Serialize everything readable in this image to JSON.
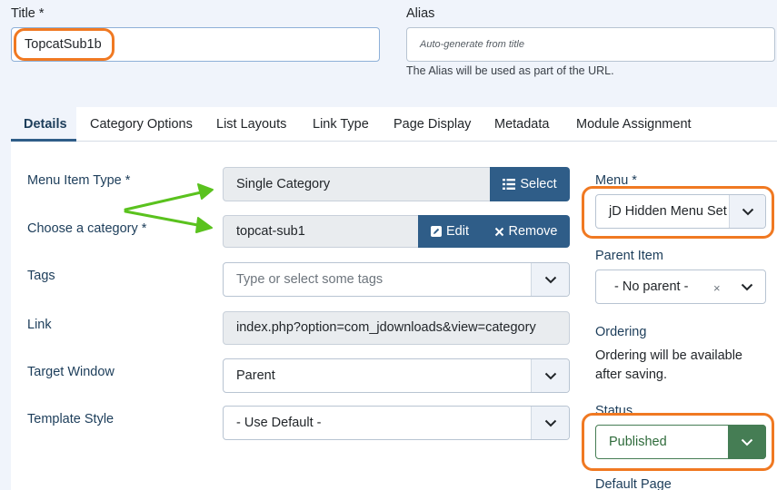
{
  "title_field": {
    "label": "Title *",
    "value": "TopcatSub1b"
  },
  "alias_field": {
    "label": "Alias",
    "placeholder": "Auto-generate from title",
    "hint": "The Alias will be used as part of the URL."
  },
  "tabs": [
    "Details",
    "Category Options",
    "List Layouts",
    "Link Type",
    "Page Display",
    "Metadata",
    "Module Assignment"
  ],
  "details": {
    "menu_item_type": {
      "label": "Menu Item Type *",
      "value": "Single Category",
      "select_label": "Select"
    },
    "category": {
      "label": "Choose a category *",
      "value": "topcat-sub1",
      "edit_label": "Edit",
      "remove_label": "Remove"
    },
    "tags": {
      "label": "Tags",
      "placeholder": "Type or select some tags"
    },
    "link": {
      "label": "Link",
      "value": "index.php?option=com_jdownloads&view=category"
    },
    "target_window": {
      "label": "Target Window",
      "value": "Parent"
    },
    "template_style": {
      "label": "Template Style",
      "value": "- Use Default -"
    }
  },
  "sidebar": {
    "menu": {
      "label": "Menu *",
      "value": "jD Hidden Menu Set"
    },
    "parent_item": {
      "label": "Parent Item",
      "value": "- No parent -",
      "clear": "×"
    },
    "ordering": {
      "label": "Ordering",
      "note": "Ordering will be available after saving."
    },
    "status": {
      "label": "Status",
      "value": "Published"
    },
    "default_page": {
      "label": "Default Page"
    }
  },
  "colors": {
    "accent": "#2f5d88",
    "highlight": "#f07922",
    "arrow": "#5ac21e",
    "published": "#457d54"
  }
}
